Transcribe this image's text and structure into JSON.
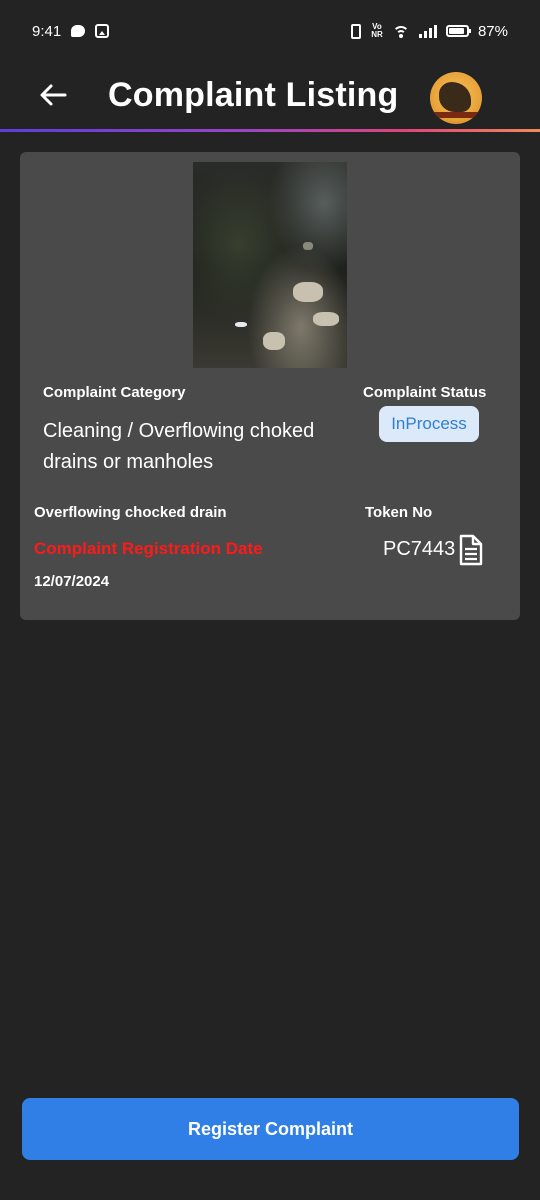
{
  "status_bar": {
    "time": "9:41",
    "network_label": "Vo NR",
    "battery": "87%"
  },
  "header": {
    "title": "Complaint Listing",
    "divider_colors": [
      "#5b3fd9",
      "#e0457b",
      "#f08a5b"
    ]
  },
  "complaint": {
    "category_label": "Complaint Category",
    "category_value": "Cleaning / Overflowing choked drains or manholes",
    "status_label": "Complaint Status",
    "status_value": "InProcess",
    "description": "Overflowing chocked drain",
    "token_label": "Token No",
    "token_value": "PC7443",
    "date_label": "Complaint Registration Date",
    "date_value": "12/07/2024",
    "date_label_color": "#ff1a1a",
    "status_badge_color": "#dbe9f8"
  },
  "actions": {
    "register_label": "Register Complaint",
    "register_color": "#2f7fe6"
  }
}
